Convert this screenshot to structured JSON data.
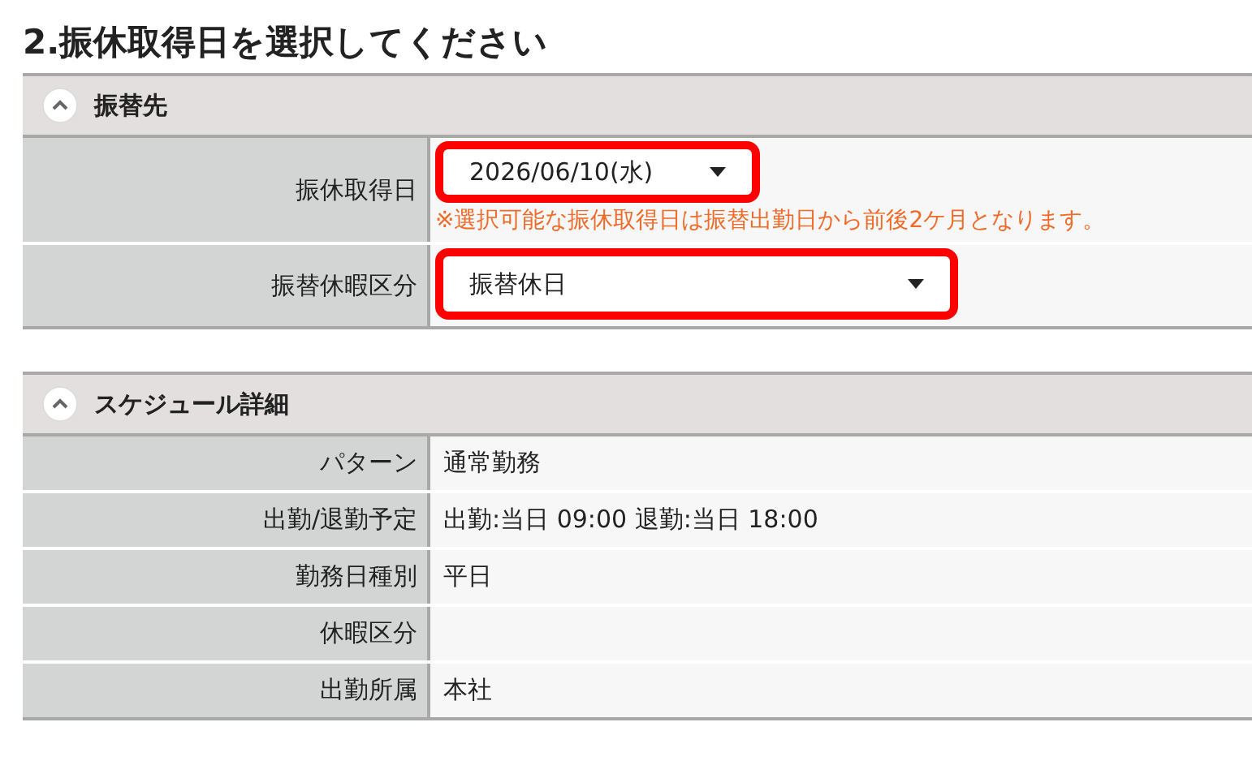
{
  "page_title": "2.振休取得日を選択してください",
  "sections": [
    {
      "title": "振替先",
      "expanded": true,
      "rows": [
        {
          "kind": "select",
          "label": "振休取得日",
          "value": "2026/06/10(水)",
          "highlighted": true,
          "note": "※選択可能な振休取得日は振替出勤日から前後2ケ月となります。"
        },
        {
          "kind": "select",
          "label": "振替休暇区分",
          "value": "振替休日",
          "highlighted": true,
          "wide": true
        }
      ]
    },
    {
      "title": "スケジュール詳細",
      "expanded": true,
      "rows": [
        {
          "kind": "text",
          "label": "パターン",
          "value": "通常勤務"
        },
        {
          "kind": "text",
          "label": "出勤/退勤予定",
          "value": "出勤:当日 09:00 退勤:当日 18:00"
        },
        {
          "kind": "text",
          "label": "勤務日種別",
          "value": "平日"
        },
        {
          "kind": "text",
          "label": "休暇区分"
        },
        {
          "kind": "text",
          "label": "出勤所属",
          "value": "本社"
        }
      ]
    }
  ]
}
